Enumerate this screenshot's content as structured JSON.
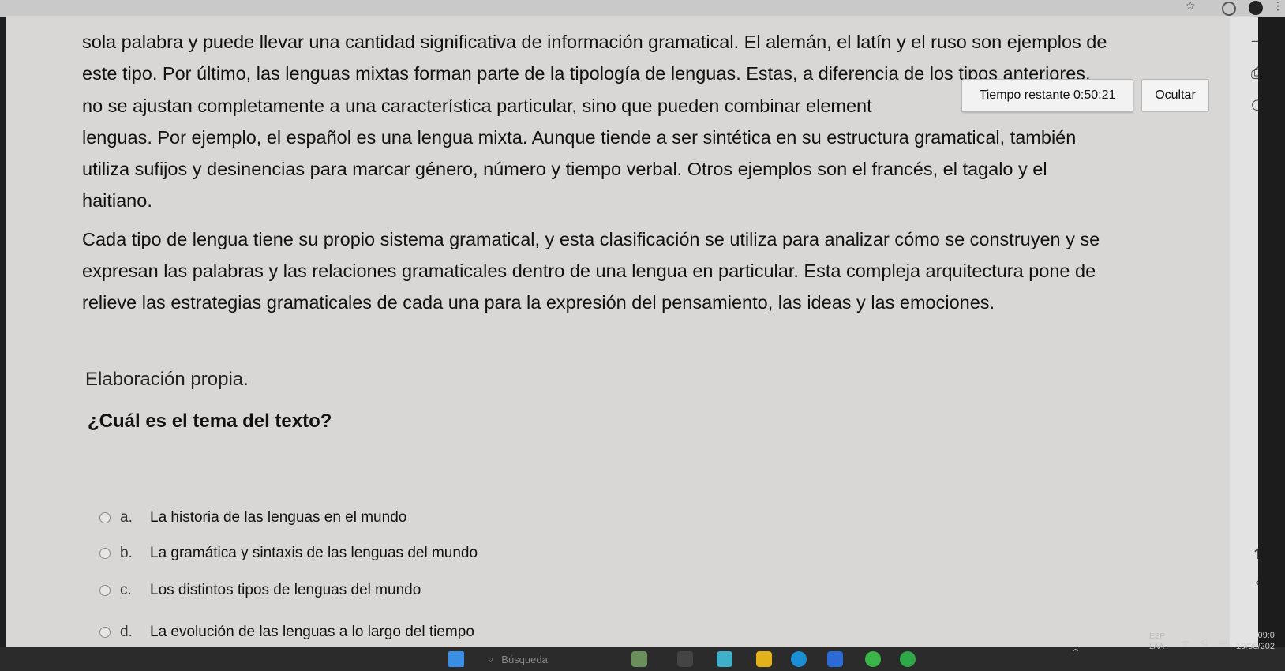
{
  "passage": {
    "lines": [
      "sola palabra y puede llevar una cantidad significativa de información gramatical. El alemán, el latín y el ruso son ejemplos de",
      "este tipo. Por último, las lenguas mixtas forman parte de la tipología de lenguas. Estas, a diferencia de los tipos anteriores,",
      "no se ajustan completamente a una característica particular, sino que pueden combinar element",
      "lenguas. Por ejemplo, el español es una lengua mixta. Aunque tiende a ser sintética en su estructura gramatical, también",
      "utiliza sufijos y desinencias para marcar género, número y tiempo verbal. Otros ejemplos son el francés, el tagalo y el",
      "haitiano.",
      "Cada tipo de lengua tiene su propio sistema gramatical, y esta clasificación se utiliza para analizar cómo se construyen y se",
      "expresan las palabras y las relaciones gramaticales dentro de una lengua en particular. Esta compleja arquitectura pone de",
      "relieve las estrategias gramaticales de cada una para la expresión del pensamiento, las ideas y las emociones."
    ]
  },
  "caption": "Elaboración propia.",
  "question": "¿Cuál es el tema del texto?",
  "options": [
    {
      "letter": "a.",
      "text": "La historia de las lenguas en el mundo"
    },
    {
      "letter": "b.",
      "text": "La gramática y sintaxis de las lenguas del mundo"
    },
    {
      "letter": "c.",
      "text": "Los distintos tipos de lenguas del mundo"
    },
    {
      "letter": "d.",
      "text": "La evolución de las lenguas a lo largo del tiempo"
    }
  ],
  "timer": {
    "label": "Tiempo restante",
    "value": "0:50:21"
  },
  "hide_button": "Ocultar",
  "taskbar": {
    "search_placeholder": "Búsqueda",
    "lang_top": "ESP",
    "lang_bottom": "LAA",
    "time": "09:0",
    "date": "19/05/202"
  },
  "icons": [
    "star-icon",
    "extension-icon",
    "profile-avatar",
    "menu-icon",
    "printer-icon",
    "chat-icon",
    "arrow-up-icon",
    "chevron-left-icon",
    "windows-start-icon",
    "search-icon",
    "wifi-icon",
    "volume-icon",
    "battery-icon"
  ]
}
